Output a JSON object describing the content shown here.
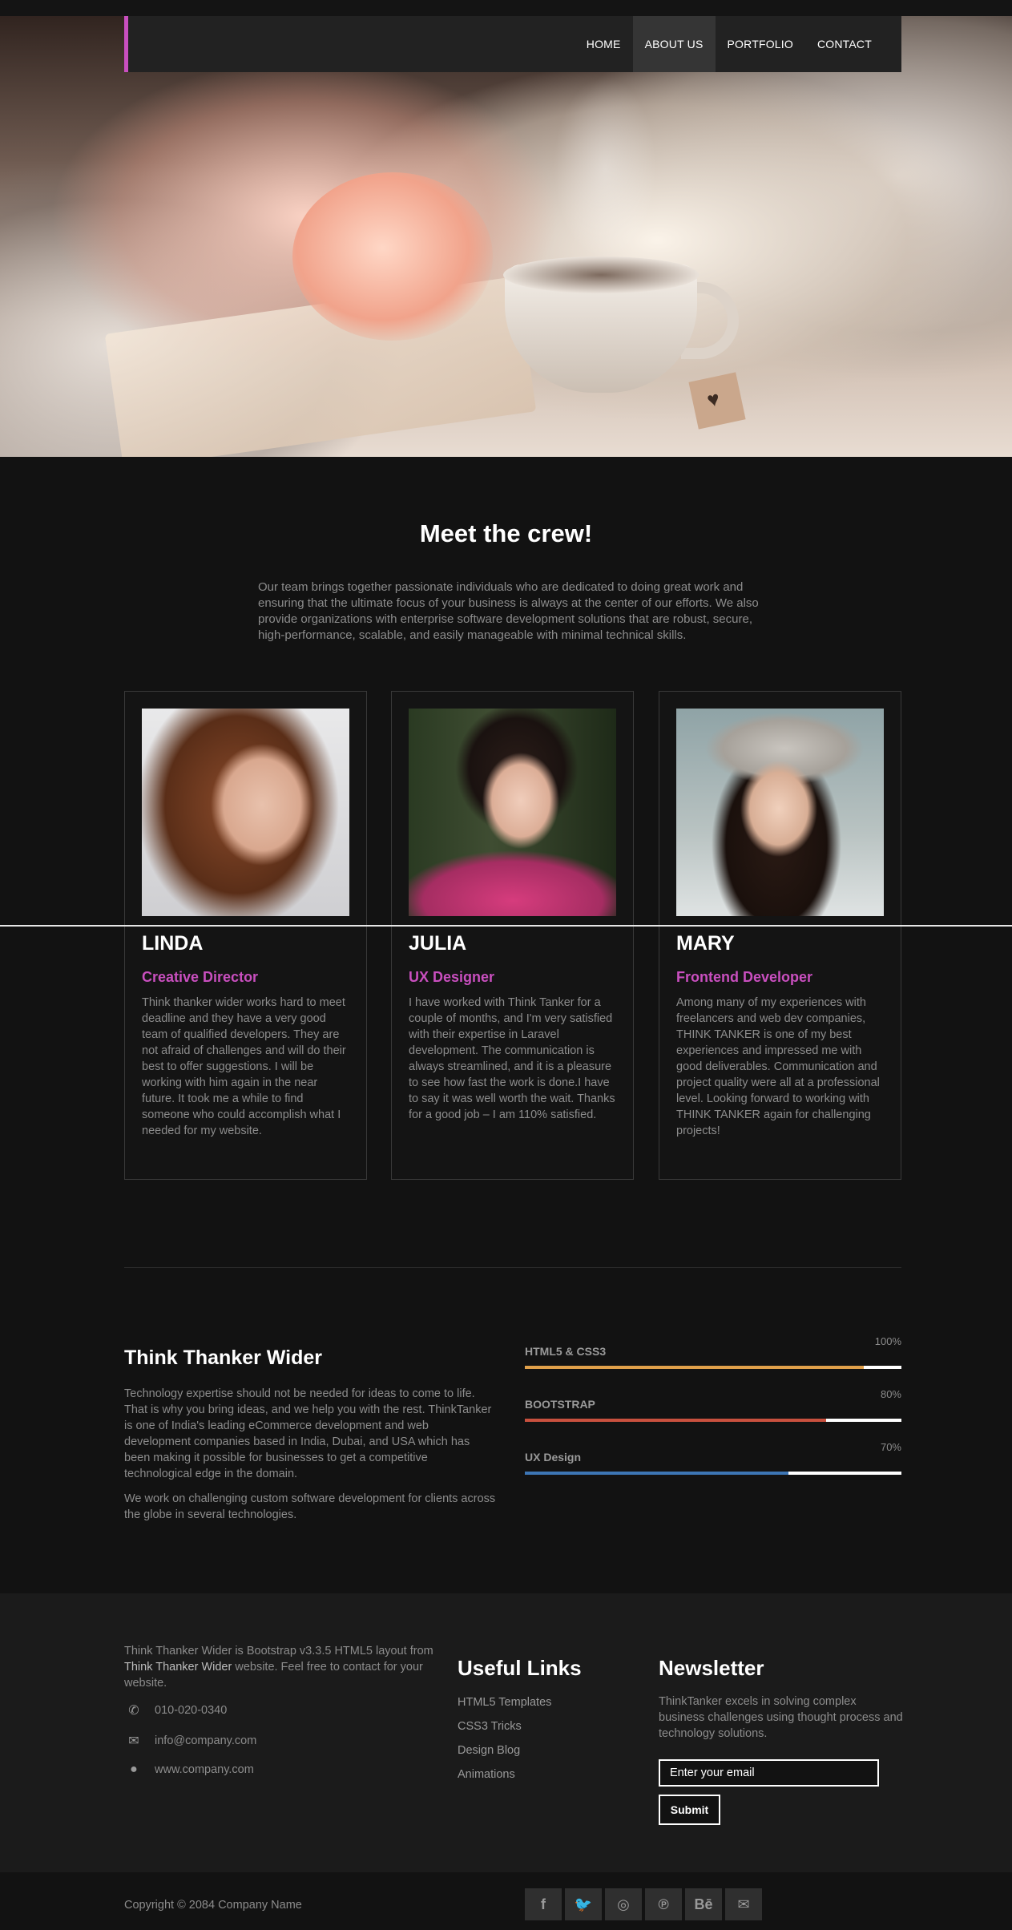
{
  "nav": {
    "items": [
      {
        "label": "HOME",
        "active": false
      },
      {
        "label": "ABOUT US",
        "active": true
      },
      {
        "label": "PORTFOLIO",
        "active": false
      },
      {
        "label": "CONTACT",
        "active": false
      }
    ],
    "accent": "#c94fbf"
  },
  "crew": {
    "title": "Meet the crew!",
    "intro": "Our team brings together passionate individuals who are dedicated to doing great work and ensuring that the ultimate focus of your business is always at the center of our efforts. We also provide organizations with enterprise software development solutions that are robust, secure, high-performance, scalable, and easily manageable with minimal technical skills.",
    "members": [
      {
        "name": "LINDA",
        "role": "Creative Director",
        "bio": "Think thanker wider works hard to meet deadline and they have a very good team of qualified developers. They are not afraid of challenges and will do their best to offer suggestions. I will be working with him again in the near future. It took me a while to find someone who could accomplish what I needed for my website."
      },
      {
        "name": "JULIA",
        "role": "UX Designer",
        "bio": "I have worked with Think Tanker for a couple of months, and I'm very satisfied with their expertise in Laravel development. The communication is always streamlined, and it is a pleasure to see how fast the work is done.I have to say it was well worth the wait. Thanks for a good job – I am 110% satisfied."
      },
      {
        "name": "MARY",
        "role": "Frontend Developer",
        "bio": "Among many of my experiences with freelancers and web dev companies, THINK TANKER is one of my best experiences and impressed me with good deliverables. Communication and project quality were all at a professional level. Looking forward to working with THINK TANKER again for challenging projects!"
      }
    ]
  },
  "about": {
    "title": "Think Thanker Wider",
    "paragraphs": [
      "Technology expertise should not be needed for ideas to come to life. That is why you bring ideas, and we help you with the rest. ThinkTanker is one of India's leading eCommerce development and web development companies based in India, Dubai, and USA which has been making it possible for businesses to get a competitive technological edge in the domain.",
      "We work on challenging custom software development for clients across the globe in several technologies."
    ]
  },
  "skills": [
    {
      "label": "HTML5 & CSS3",
      "percent_text": "100%",
      "fill": 0.9,
      "color": "#e0a04a"
    },
    {
      "label": "BOOTSTRAP",
      "percent_text": "80%",
      "fill": 0.8,
      "color": "#c8503e"
    },
    {
      "label": "UX Design",
      "percent_text": "70%",
      "fill": 0.7,
      "color": "#3d76b5"
    }
  ],
  "footer": {
    "about_pre": "Think Thanker Wider is Bootstrap v3.3.5 HTML5 layout from ",
    "about_strong": "Think Thanker Wider",
    "about_post": " website. Feel free to contact for your website.",
    "phone": "010-020-0340",
    "email": "info@company.com",
    "website": "www.company.com",
    "links_title": "Useful Links",
    "links": [
      "HTML5 Templates",
      "CSS3 Tricks",
      "Design Blog",
      "Animations"
    ],
    "newsletter_title": "Newsletter",
    "newsletter_text": "ThinkTanker excels in solving complex business challenges using thought process and technology solutions.",
    "email_placeholder": "Enter your email",
    "submit_label": "Submit",
    "copyright": "Copyright © 2084 Company Name",
    "socials": [
      {
        "icon": "facebook-icon",
        "glyph": "f"
      },
      {
        "icon": "twitter-icon",
        "glyph": "🐦"
      },
      {
        "icon": "dribbble-icon",
        "glyph": "◎"
      },
      {
        "icon": "pinterest-icon",
        "glyph": "℗"
      },
      {
        "icon": "behance-icon",
        "glyph": "Bē"
      },
      {
        "icon": "mail-icon",
        "glyph": "✉"
      }
    ]
  }
}
